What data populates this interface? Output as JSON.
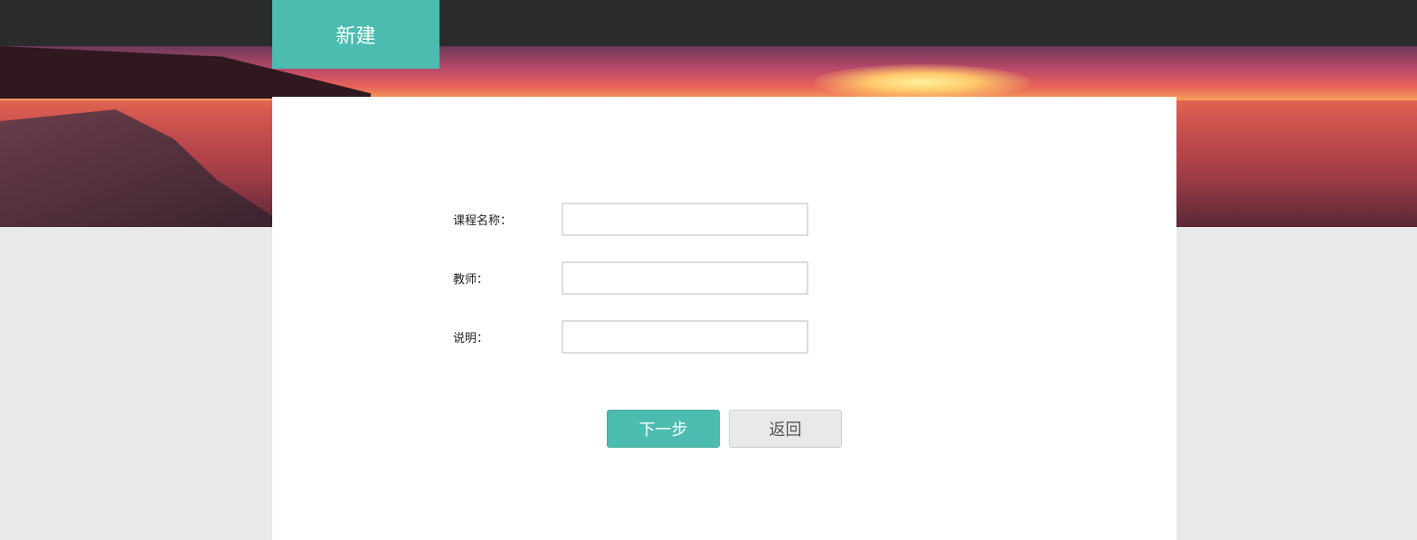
{
  "header": {
    "tab_label": "新建"
  },
  "form": {
    "fields": [
      {
        "label": "课程名称：",
        "value": "",
        "placeholder": ""
      },
      {
        "label": "教师：",
        "value": "",
        "placeholder": ""
      },
      {
        "label": "说明：",
        "value": "",
        "placeholder": ""
      }
    ],
    "next_label": "下一步",
    "back_label": "返回"
  },
  "colors": {
    "accent": "#4cbcb0",
    "topbar": "#2a2b2d",
    "page_bg": "#e8e9eb"
  }
}
